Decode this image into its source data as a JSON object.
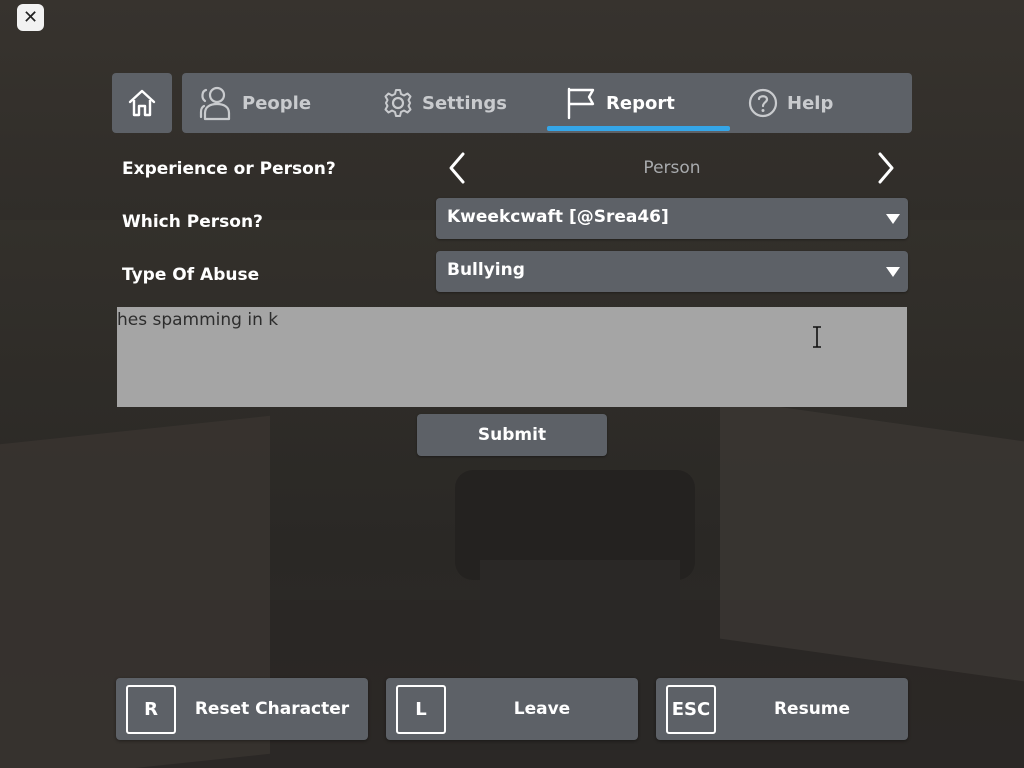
{
  "close_button": {
    "label": "✕"
  },
  "tabs": [
    {
      "label": "People",
      "icon": "people-icon"
    },
    {
      "label": "Settings",
      "icon": "gear-icon"
    },
    {
      "label": "Report",
      "icon": "flag-icon"
    },
    {
      "label": "Help",
      "icon": "help-icon"
    }
  ],
  "active_tab": "Report",
  "report_form": {
    "experience_or_person_label": "Experience or Person?",
    "experience_or_person_value": "Person",
    "which_person_label": "Which Person?",
    "which_person_value": "Kweekcwaft [@Srea46]",
    "type_of_abuse_label": "Type Of Abuse",
    "type_of_abuse_value": "Bullying",
    "description_value": "hes spamming in k",
    "submit_label": "Submit"
  },
  "bottom_bar": [
    {
      "key": "R",
      "label": "Reset Character"
    },
    {
      "key": "L",
      "label": "Leave"
    },
    {
      "key": "ESC",
      "label": "Resume"
    }
  ],
  "colors": {
    "panel": "#5d6167",
    "active_underline": "#35a6e8",
    "text_box": "#a5a5a5"
  }
}
